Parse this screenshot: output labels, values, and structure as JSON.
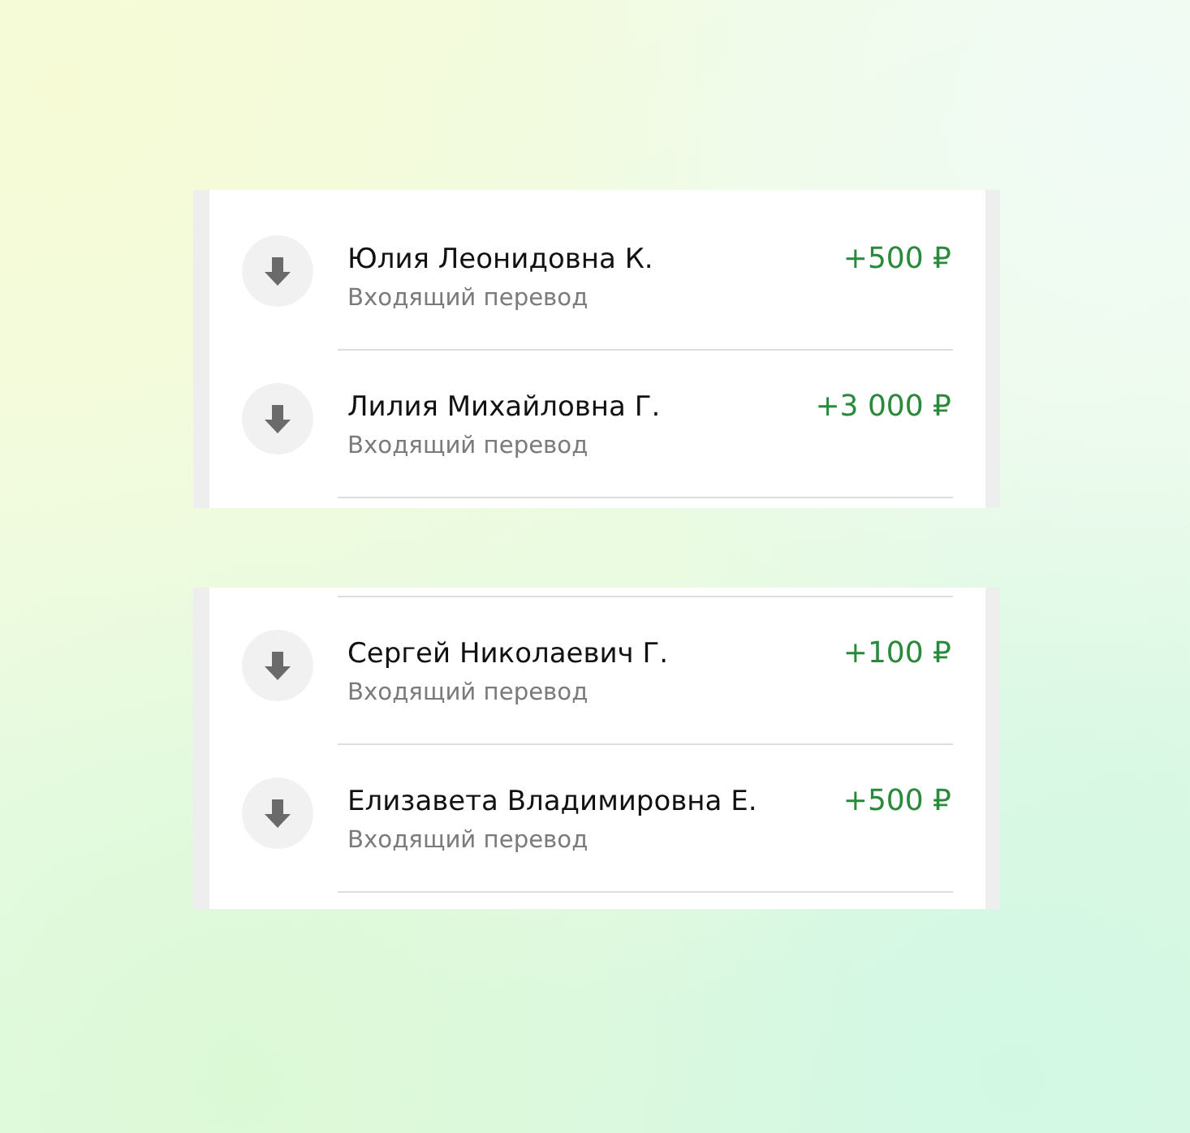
{
  "cards": [
    {
      "divider_above": false,
      "transactions": [
        {
          "kind": "incoming",
          "name": "Юлия Леонидовна К.",
          "type": "Входящий перевод",
          "amount": "+500 ₽"
        },
        {
          "kind": "incoming",
          "name": "Лилия Михайловна Г.",
          "type": "Входящий перевод",
          "amount": "+3 000 ₽"
        }
      ]
    },
    {
      "divider_above": true,
      "transactions": [
        {
          "kind": "incoming",
          "name": "Сергей Николаевич Г.",
          "type": "Входящий перевод",
          "amount": "+100 ₽"
        },
        {
          "kind": "incoming",
          "name": "Елизавета Владимировна Е.",
          "type": "Входящий перевод",
          "amount": "+500 ₽"
        }
      ]
    }
  ]
}
